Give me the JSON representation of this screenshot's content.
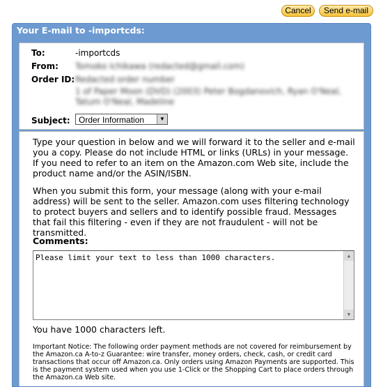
{
  "toolbar": {
    "cancel_label": "Cancel",
    "send_label": "Send e-mail"
  },
  "panel": {
    "title": "Your E-mail to -importcds:"
  },
  "details": {
    "to_label": "To:",
    "to_value": "-importcds",
    "from_label": "From:",
    "from_value": "Tomoko Ichikawa  (redacted@gmail.com)",
    "order_label": "Order ID:",
    "order_value_line1": "Redacted order number",
    "order_value_line2": "1 of Paper Moon (DVD) (2003) Peter Bogdanovich, Ryan O'Neal,",
    "order_value_line3": "Tatum O'Neal, Madeline",
    "subject_label": "Subject:",
    "subject_value": "Order Information"
  },
  "info": {
    "para1": "Type your question in below and we will forward it to the seller and e-mail you a copy. Please do not include HTML or links (URLs) in your message. If you need to refer to an item on the Amazon.com Web site, include the product name and/or the ASIN/ISBN.",
    "para2": "When you submit this form, your message (along with your e-mail address) will be sent to the seller. Amazon.com uses filtering technology to protect buyers and sellers and to identify possible fraud. Messages that fail this filtering - even if they are not fraudulent - will not be transmitted.",
    "comments_label": "Comments:",
    "comments_value": "Please limit your text to less than 1000 characters.",
    "chars_left": "You have 1000 characters left.",
    "notice": "Important Notice: The following order payment methods are not covered for reimbursement by the Amazon.ca A-to-z Guarantee: wire transfer, money orders, check, cash, or credit card transactions that occur off Amazon.ca. Only orders using Amazon Payments are supported. This is the payment system used when you use 1-Click or the Shopping Cart to place orders through the Amazon.ca Web site."
  },
  "colors": {
    "panel_blue": "#6d9ad1",
    "button_gold": "#f7c43d"
  }
}
